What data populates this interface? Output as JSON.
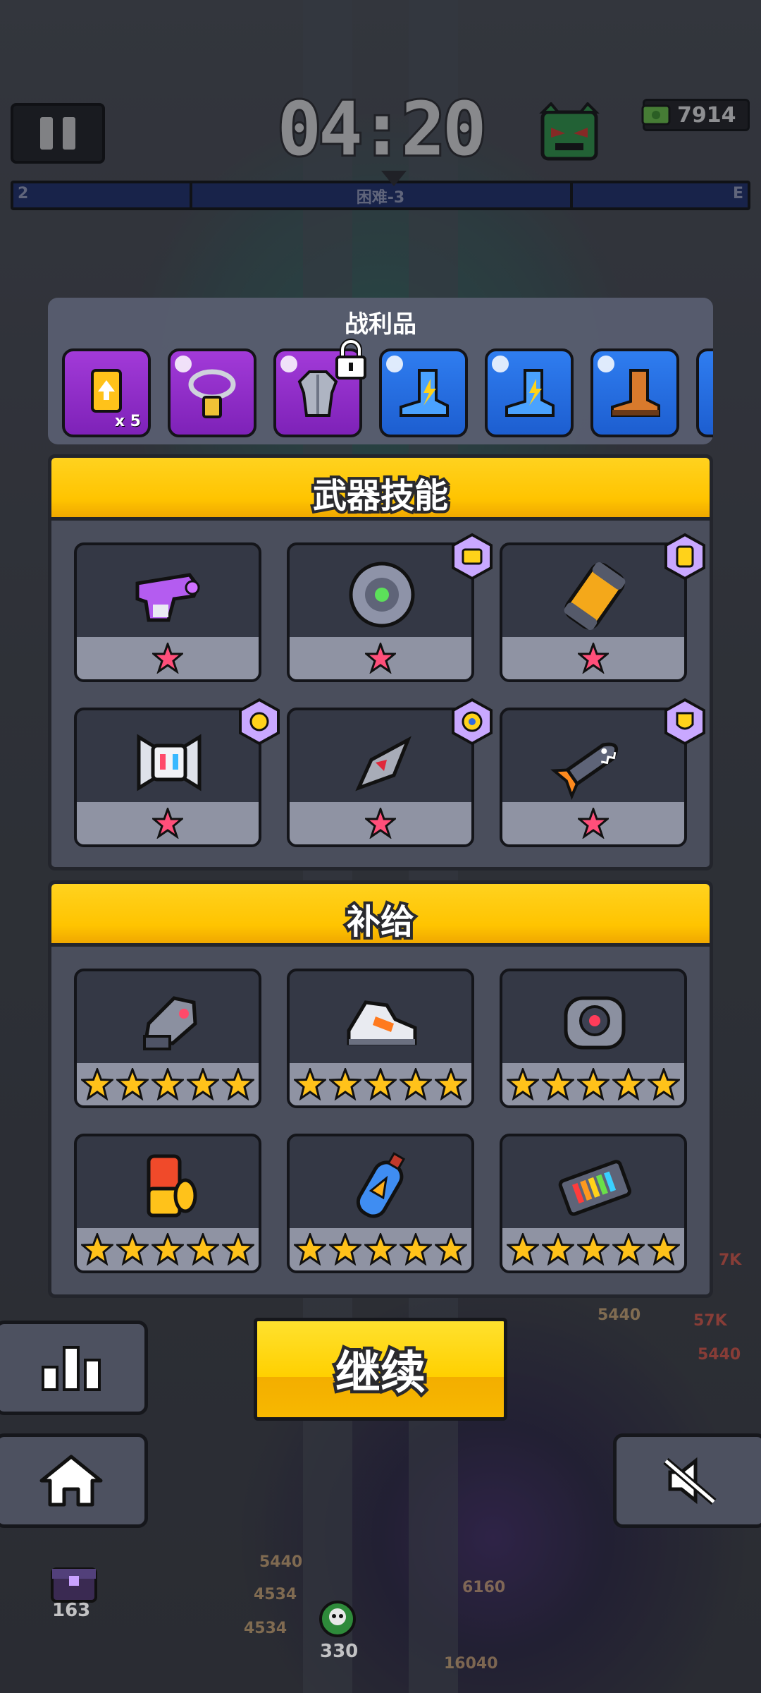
{
  "hud": {
    "timer": "04:20",
    "coins": "7914",
    "stage_label": "困难-3",
    "stage_left": "2",
    "stage_right": "E"
  },
  "loot": {
    "title": "战利品",
    "items": [
      {
        "name": "upgrade-card",
        "rarity": "purple",
        "qty": "x 5"
      },
      {
        "name": "necklace",
        "rarity": "purple",
        "qty": ""
      },
      {
        "name": "armor",
        "rarity": "purple",
        "qty": ""
      },
      {
        "name": "blue-boot",
        "rarity": "blue",
        "qty": ""
      },
      {
        "name": "blue-boot",
        "rarity": "blue",
        "qty": ""
      },
      {
        "name": "brown-boot",
        "rarity": "blue",
        "qty": ""
      }
    ]
  },
  "weapon_skills": {
    "title": "武器技能",
    "items": [
      {
        "icon": "purple-gun-icon",
        "stars": 1,
        "badge": ""
      },
      {
        "icon": "orb-drone-icon",
        "stars": 1,
        "badge": "robot-badge-icon"
      },
      {
        "icon": "fuel-canister-icon",
        "stars": 1,
        "badge": "canister-badge-icon"
      },
      {
        "icon": "robot-head-icon",
        "stars": 1,
        "badge": "gear-badge-icon"
      },
      {
        "icon": "blade-icon",
        "stars": 1,
        "badge": "target-badge-icon"
      },
      {
        "icon": "shark-rocket-icon",
        "stars": 1,
        "badge": "shield-badge-icon"
      }
    ]
  },
  "supplies": {
    "title": "补给",
    "items": [
      {
        "icon": "arm-guard-icon",
        "stars": 5
      },
      {
        "icon": "sneaker-icon",
        "stars": 5
      },
      {
        "icon": "energy-core-icon",
        "stars": 5
      },
      {
        "icon": "battery-icon",
        "stars": 5
      },
      {
        "icon": "oxygen-tank-icon",
        "stars": 5
      },
      {
        "icon": "power-cell-icon",
        "stars": 5
      }
    ]
  },
  "buttons": {
    "continue": "继续"
  },
  "background_numbers": {
    "chest_count": "163",
    "kill_count": "330",
    "damage_labels": [
      "5440",
      "4534",
      "4534",
      "5440",
      "5440",
      "57K",
      "7K",
      "6160",
      "16040"
    ]
  },
  "colors": {
    "accent_yellow": "#ffc400",
    "panel": "#4a4e5c",
    "rarity_purple": "#9a32d2",
    "rarity_blue": "#2a72e8"
  }
}
